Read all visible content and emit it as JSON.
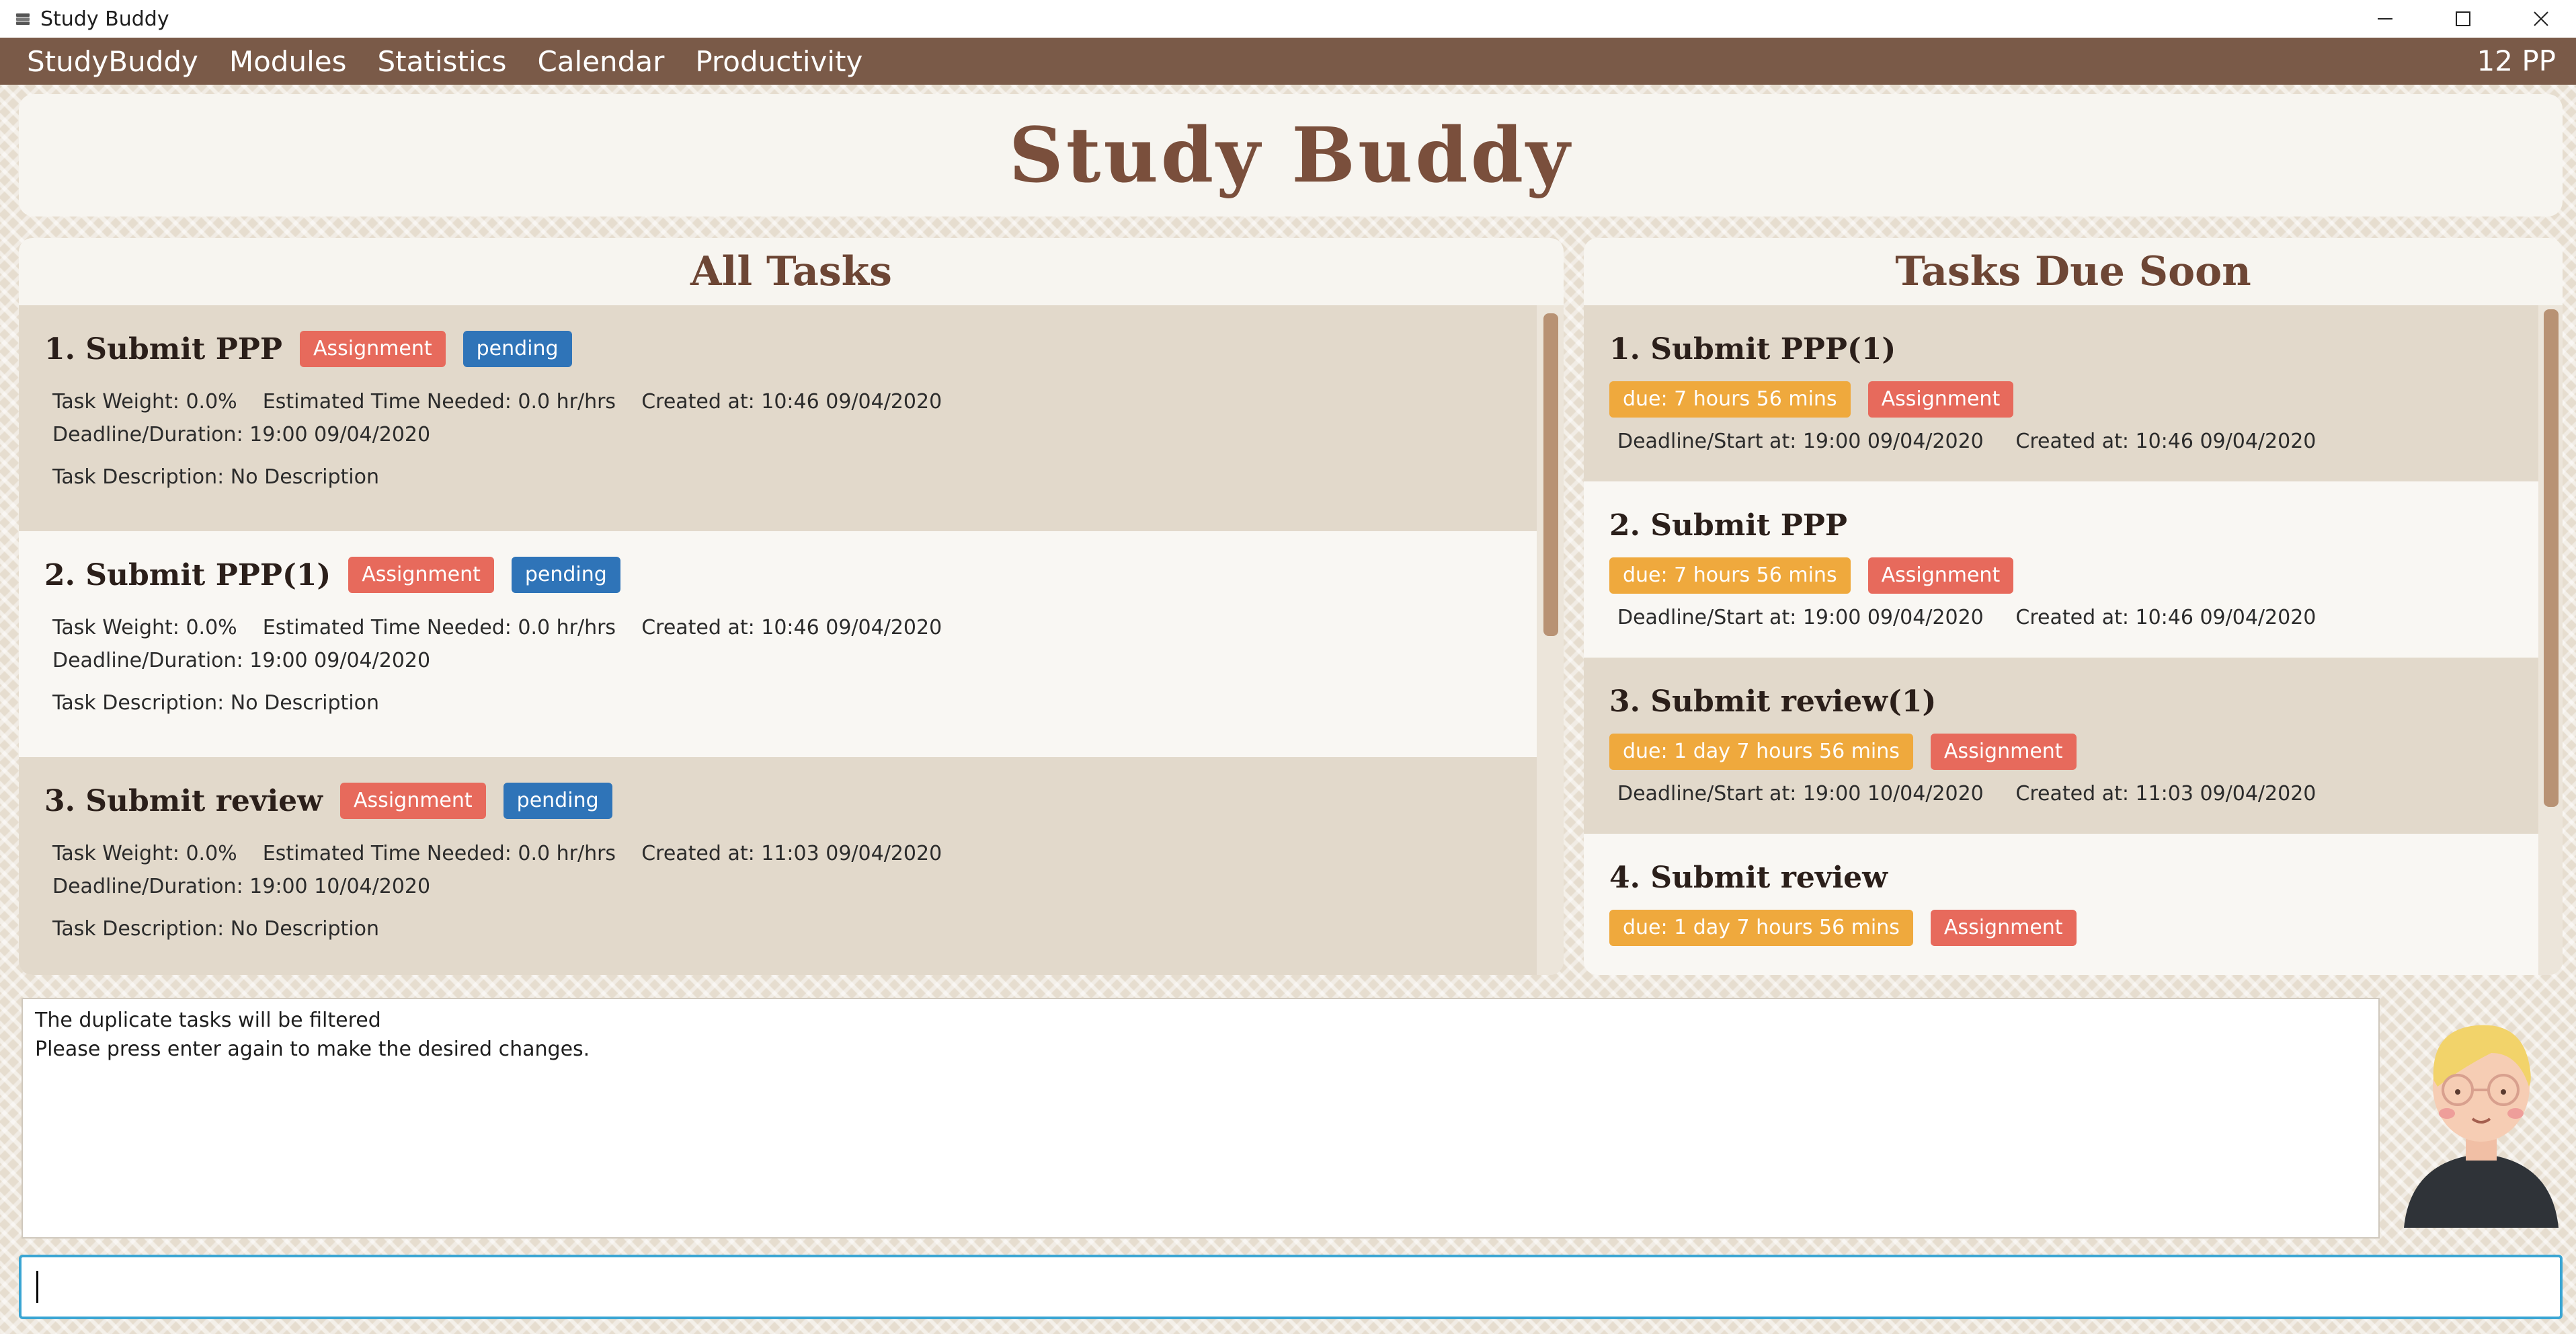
{
  "window": {
    "title": "Study Buddy"
  },
  "menu": {
    "items": [
      "StudyBuddy",
      "Modules",
      "Statistics",
      "Calendar",
      "Productivity"
    ],
    "points": "12 PP"
  },
  "header": {
    "title": "Study Buddy"
  },
  "all_tasks": {
    "title": "All Tasks",
    "items": [
      {
        "title": "1.  Submit PPP",
        "module": "Assignment",
        "status": "pending",
        "info": "Task Weight: 0.0%    Estimated Time Needed: 0.0 hr/hrs    Created at: 10:46 09/04/2020",
        "deadline": "Deadline/Duration: 19:00 09/04/2020",
        "description": "Task Description: No Description"
      },
      {
        "title": "2.  Submit PPP(1)",
        "module": "Assignment",
        "status": "pending",
        "info": "Task Weight: 0.0%    Estimated Time Needed: 0.0 hr/hrs    Created at: 10:46 09/04/2020",
        "deadline": "Deadline/Duration: 19:00 09/04/2020",
        "description": "Task Description: No Description"
      },
      {
        "title": "3.  Submit review",
        "module": "Assignment",
        "status": "pending",
        "info": "Task Weight: 0.0%    Estimated Time Needed: 0.0 hr/hrs    Created at: 11:03 09/04/2020",
        "deadline": "Deadline/Duration: 19:00 10/04/2020",
        "description": "Task Description: No Description"
      }
    ]
  },
  "due_soon": {
    "title": "Tasks Due Soon",
    "items": [
      {
        "title": "1.  Submit PPP(1)",
        "due": "due: 7 hours 56 mins",
        "module": "Assignment",
        "details": "Deadline/Start at: 19:00 09/04/2020     Created at: 10:46 09/04/2020"
      },
      {
        "title": "2.  Submit PPP",
        "due": "due: 7 hours 56 mins",
        "module": "Assignment",
        "details": "Deadline/Start at: 19:00 09/04/2020     Created at: 10:46 09/04/2020"
      },
      {
        "title": "3.  Submit review(1)",
        "due": "due: 1 day 7 hours 56 mins",
        "module": "Assignment",
        "details": "Deadline/Start at: 19:00 10/04/2020     Created at: 11:03 09/04/2020"
      },
      {
        "title": "4.  Submit review",
        "due": "due: 1 day 7 hours 56 mins",
        "module": "Assignment",
        "details": ""
      }
    ]
  },
  "result": {
    "lines": [
      "The duplicate tasks will be filtered",
      "Please press enter again to make the desired changes."
    ]
  },
  "command": {
    "value": ""
  },
  "colors": {
    "menu_bar": "#7a5a48",
    "heading": "#7a4f3c",
    "badge_assignment": "#e76a5c",
    "badge_pending": "#2f74b8",
    "badge_due": "#efa93d",
    "command_border": "#3aa5d3"
  }
}
